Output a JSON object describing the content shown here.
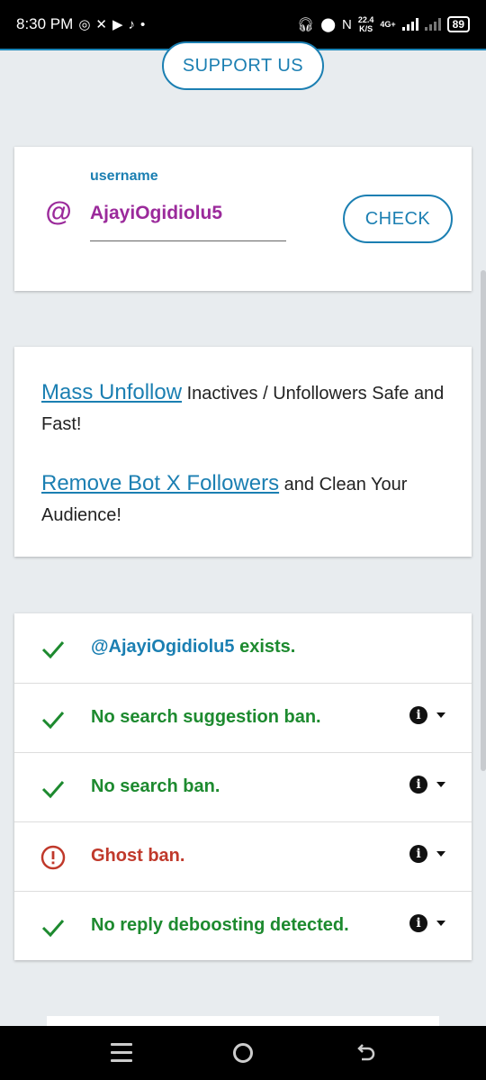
{
  "status_bar": {
    "time": "8:30 PM",
    "app_icons": [
      "whatsapp-icon",
      "x-icon",
      "youtube-icon",
      "tiktok-icon",
      "dot-icon"
    ],
    "speed_value": "22.4",
    "speed_unit": "K/S",
    "network": "4G+",
    "battery": "89"
  },
  "support_button": "SUPPORT US",
  "username_card": {
    "label": "username",
    "at_symbol": "@",
    "value": "AjayiOgidiolu5",
    "check_button": "CHECK"
  },
  "promo": {
    "line1_link": "Mass Unfollow",
    "line1_text": " Inactives / Unfollowers Safe and Fast!",
    "line2_link": "Remove Bot X Followers",
    "line2_text": " and Clean Your Audience!"
  },
  "results": [
    {
      "handle": "@AjayiOgidiolu5",
      "text": " exists.",
      "status": "ok",
      "has_info": false
    },
    {
      "handle": "",
      "text": "No search suggestion ban.",
      "status": "ok",
      "has_info": true
    },
    {
      "handle": "",
      "text": "No search ban.",
      "status": "ok",
      "has_info": true
    },
    {
      "handle": "",
      "text": "Ghost ban.",
      "status": "error",
      "has_info": true
    },
    {
      "handle": "",
      "text": "No reply deboosting detected.",
      "status": "ok",
      "has_info": true
    }
  ],
  "info_glyph": "i",
  "colors": {
    "accent": "#1b7fb2",
    "success": "#1d8a2f",
    "error": "#c0392b",
    "username": "#9b2a9b"
  }
}
